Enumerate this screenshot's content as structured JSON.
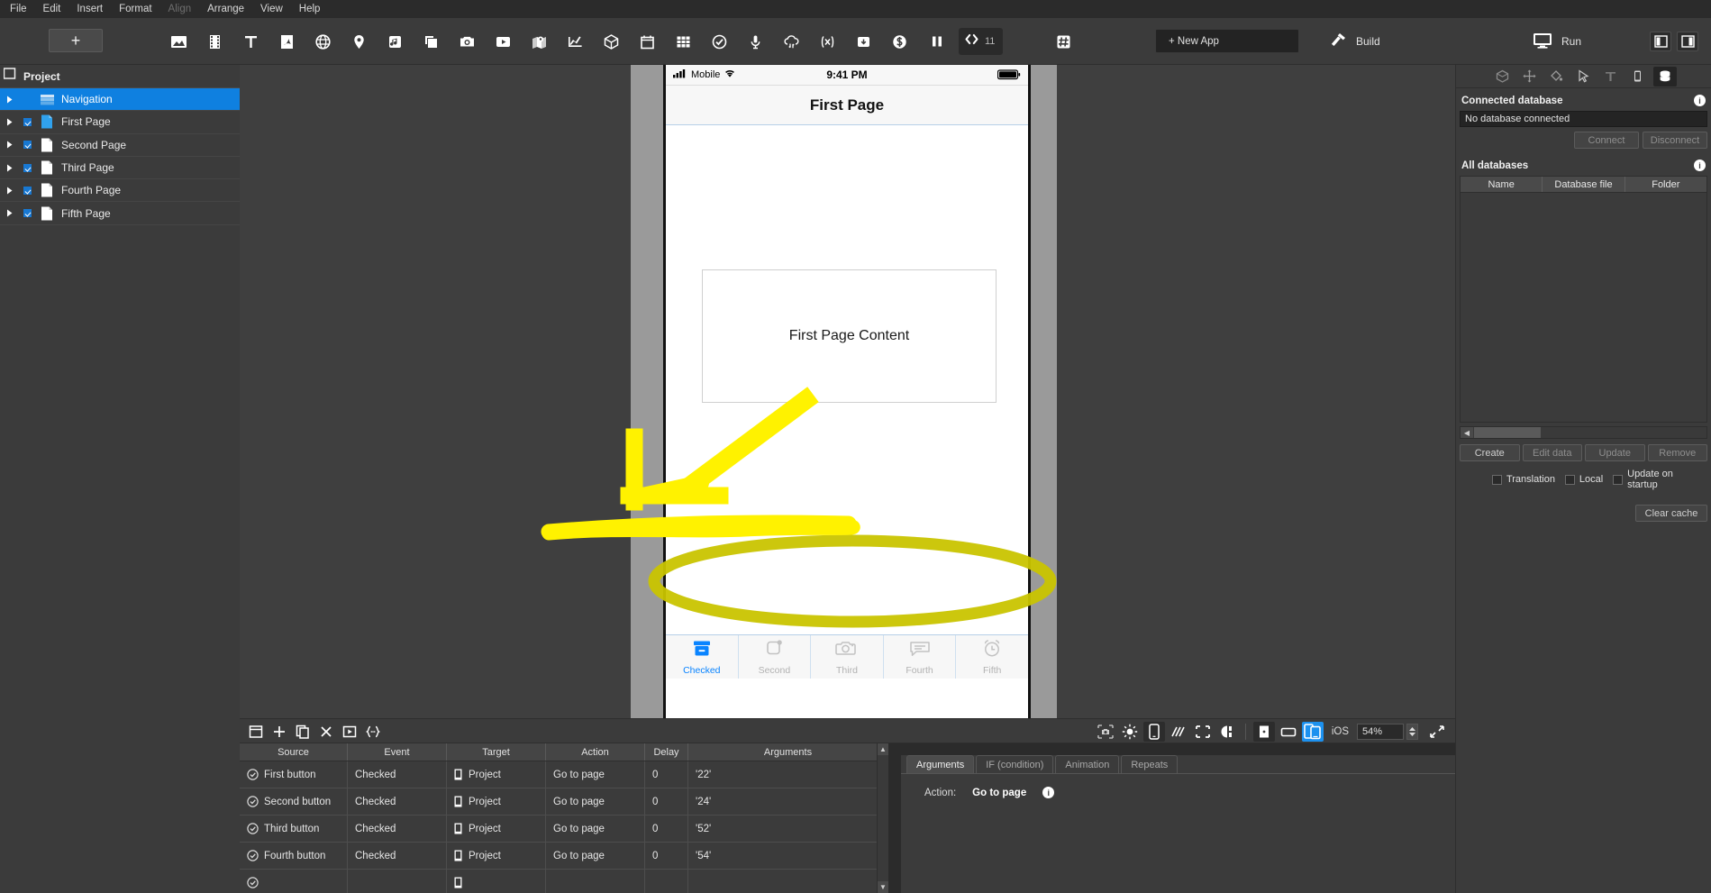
{
  "menubar": {
    "items": [
      {
        "label": "File",
        "disabled": false
      },
      {
        "label": "Edit",
        "disabled": false
      },
      {
        "label": "Insert",
        "disabled": false
      },
      {
        "label": "Format",
        "disabled": false
      },
      {
        "label": "Align",
        "disabled": true
      },
      {
        "label": "Arrange",
        "disabled": false
      },
      {
        "label": "View",
        "disabled": false
      },
      {
        "label": "Help",
        "disabled": false
      }
    ]
  },
  "toolbar": {
    "add_label": "+",
    "icons": [
      {
        "name": "image-icon"
      },
      {
        "name": "film-icon"
      },
      {
        "name": "text-icon"
      },
      {
        "name": "pdf-icon"
      },
      {
        "name": "globe-icon"
      },
      {
        "name": "map-pin-icon"
      },
      {
        "name": "music-note-icon"
      },
      {
        "name": "stack-icon"
      },
      {
        "name": "camera-icon"
      },
      {
        "name": "video-play-icon"
      },
      {
        "name": "map-route-icon"
      },
      {
        "name": "chart-line-icon"
      },
      {
        "name": "cube-3d-icon"
      },
      {
        "name": "calendar-icon"
      },
      {
        "name": "grid-icon"
      },
      {
        "name": "check-circle-icon"
      },
      {
        "name": "microphone-icon"
      },
      {
        "name": "cloud-sync-icon"
      },
      {
        "name": "variable-icon"
      },
      {
        "name": "download-box-icon"
      },
      {
        "name": "dollar-icon"
      }
    ],
    "pause_icon": "pause-icon",
    "code_icon": "code-icon",
    "code_count": "11",
    "hash_icon": "hash-icon",
    "new_app_label": "+ New App",
    "build_label": "Build",
    "build_icon": "hammer-icon",
    "run_label": "Run",
    "run_icon": "monitor-icon",
    "left_panel_toggle": "left-panel-toggle-icon",
    "right_panel_toggle": "right-panel-toggle-icon"
  },
  "project_tree": {
    "header": "Project",
    "items": [
      {
        "label": "Navigation",
        "selected": true,
        "checked": false,
        "icon": "navigation-layers-icon"
      },
      {
        "label": "First Page",
        "selected": false,
        "checked": true,
        "icon": "page-blue-icon"
      },
      {
        "label": "Second Page",
        "selected": false,
        "checked": true,
        "icon": "page-white-icon"
      },
      {
        "label": "Third Page",
        "selected": false,
        "checked": true,
        "icon": "page-white-icon"
      },
      {
        "label": "Fourth Page",
        "selected": false,
        "checked": true,
        "icon": "page-white-icon"
      },
      {
        "label": "Fifth Page",
        "selected": false,
        "checked": true,
        "icon": "page-white-icon"
      }
    ]
  },
  "preview": {
    "status_bar": {
      "carrier": "Mobile",
      "time": "9:41 PM",
      "signal_icon": "signal-bars-icon",
      "wifi_icon": "wifi-icon",
      "battery_icon": "battery-full-icon"
    },
    "nav_title": "First Page",
    "content_text": "First Page Content",
    "tabs": [
      {
        "label": "Checked",
        "icon": "archive-box-icon",
        "active": true
      },
      {
        "label": "Second",
        "icon": "rounded-square-dot-icon",
        "active": false
      },
      {
        "label": "Third",
        "icon": "camera-outline-icon",
        "active": false
      },
      {
        "label": "Fourth",
        "icon": "chat-bubble-icon",
        "active": false
      },
      {
        "label": "Fifth",
        "icon": "alarm-clock-icon",
        "active": false
      }
    ]
  },
  "canvas_toolbar": {
    "left_icons": [
      {
        "name": "new-window-icon"
      },
      {
        "name": "plus-icon"
      },
      {
        "name": "duplicate-icon"
      },
      {
        "name": "delete-x-icon"
      },
      {
        "name": "play-box-icon"
      },
      {
        "name": "braces-icon"
      }
    ],
    "right_icons": [
      {
        "name": "screenshot-icon",
        "boxed": false,
        "active": false
      },
      {
        "name": "brightness-icon",
        "boxed": false,
        "active": false
      },
      {
        "name": "device-icon",
        "boxed": true,
        "active": false
      },
      {
        "name": "diagonal-lines-icon",
        "boxed": false,
        "active": false
      },
      {
        "name": "selection-dashed-icon",
        "boxed": false,
        "active": false
      },
      {
        "name": "contrast-icon",
        "boxed": false,
        "active": false
      }
    ],
    "orientation_icons": [
      {
        "name": "portrait-icon",
        "boxed": true,
        "active": false
      },
      {
        "name": "landscape-icon",
        "boxed": false,
        "active": false
      },
      {
        "name": "devices-icon",
        "boxed": false,
        "active": true
      }
    ],
    "os_label": "iOS",
    "zoom_value": "54%",
    "fit_icon": "fit-screen-icon"
  },
  "events": {
    "columns": [
      "Source",
      "Event",
      "Target",
      "Action",
      "Delay",
      "Arguments"
    ],
    "rows": [
      {
        "source": "First button",
        "event": "Checked",
        "target": "Project",
        "action": "Go to page",
        "delay": "0",
        "arguments": "'22'"
      },
      {
        "source": "Second button",
        "event": "Checked",
        "target": "Project",
        "action": "Go to page",
        "delay": "0",
        "arguments": "'24'"
      },
      {
        "source": "Third button",
        "event": "Checked",
        "target": "Project",
        "action": "Go to page",
        "delay": "0",
        "arguments": "'52'"
      },
      {
        "source": "Fourth button",
        "event": "Checked",
        "target": "Project",
        "action": "Go to page",
        "delay": "0",
        "arguments": "'54'"
      }
    ]
  },
  "event_detail": {
    "tabs": [
      {
        "label": "Arguments",
        "active": true
      },
      {
        "label": "IF (condition)",
        "active": false
      },
      {
        "label": "Animation",
        "active": false
      },
      {
        "label": "Repeats",
        "active": false
      }
    ],
    "action_label": "Action:",
    "action_value": "Go to page",
    "info_icon": "info-icon"
  },
  "right_panel": {
    "tabs": [
      {
        "name": "cube-icon",
        "active": false
      },
      {
        "name": "move-icon",
        "active": false
      },
      {
        "name": "fill-icon",
        "active": false
      },
      {
        "name": "cursor-icon",
        "active": false
      },
      {
        "name": "text-tool-icon",
        "active": false
      },
      {
        "name": "device-tool-icon",
        "active": false
      },
      {
        "name": "database-icon",
        "active": true
      }
    ],
    "connected_db": {
      "title": "Connected database",
      "value": "No database connected",
      "connect_label": "Connect",
      "disconnect_label": "Disconnect"
    },
    "all_databases": {
      "title": "All databases",
      "columns": [
        "Name",
        "Database file",
        "Folder"
      ]
    },
    "actions": [
      {
        "label": "Create",
        "enabled": true
      },
      {
        "label": "Edit data",
        "enabled": false
      },
      {
        "label": "Update",
        "enabled": false
      },
      {
        "label": "Remove",
        "enabled": false
      }
    ],
    "checkboxes": [
      {
        "label": "Translation",
        "checked": false
      },
      {
        "label": "Local",
        "checked": false
      },
      {
        "label": "Update on startup",
        "checked": false
      }
    ],
    "clear_cache_label": "Clear cache"
  },
  "colors": {
    "accent_blue": "#0f80e0",
    "ios_blue": "#0a84ff",
    "annotation_yellow": "#fff200",
    "panel_bg": "#3b3b3b",
    "canvas_bg": "#3f3f3f"
  }
}
